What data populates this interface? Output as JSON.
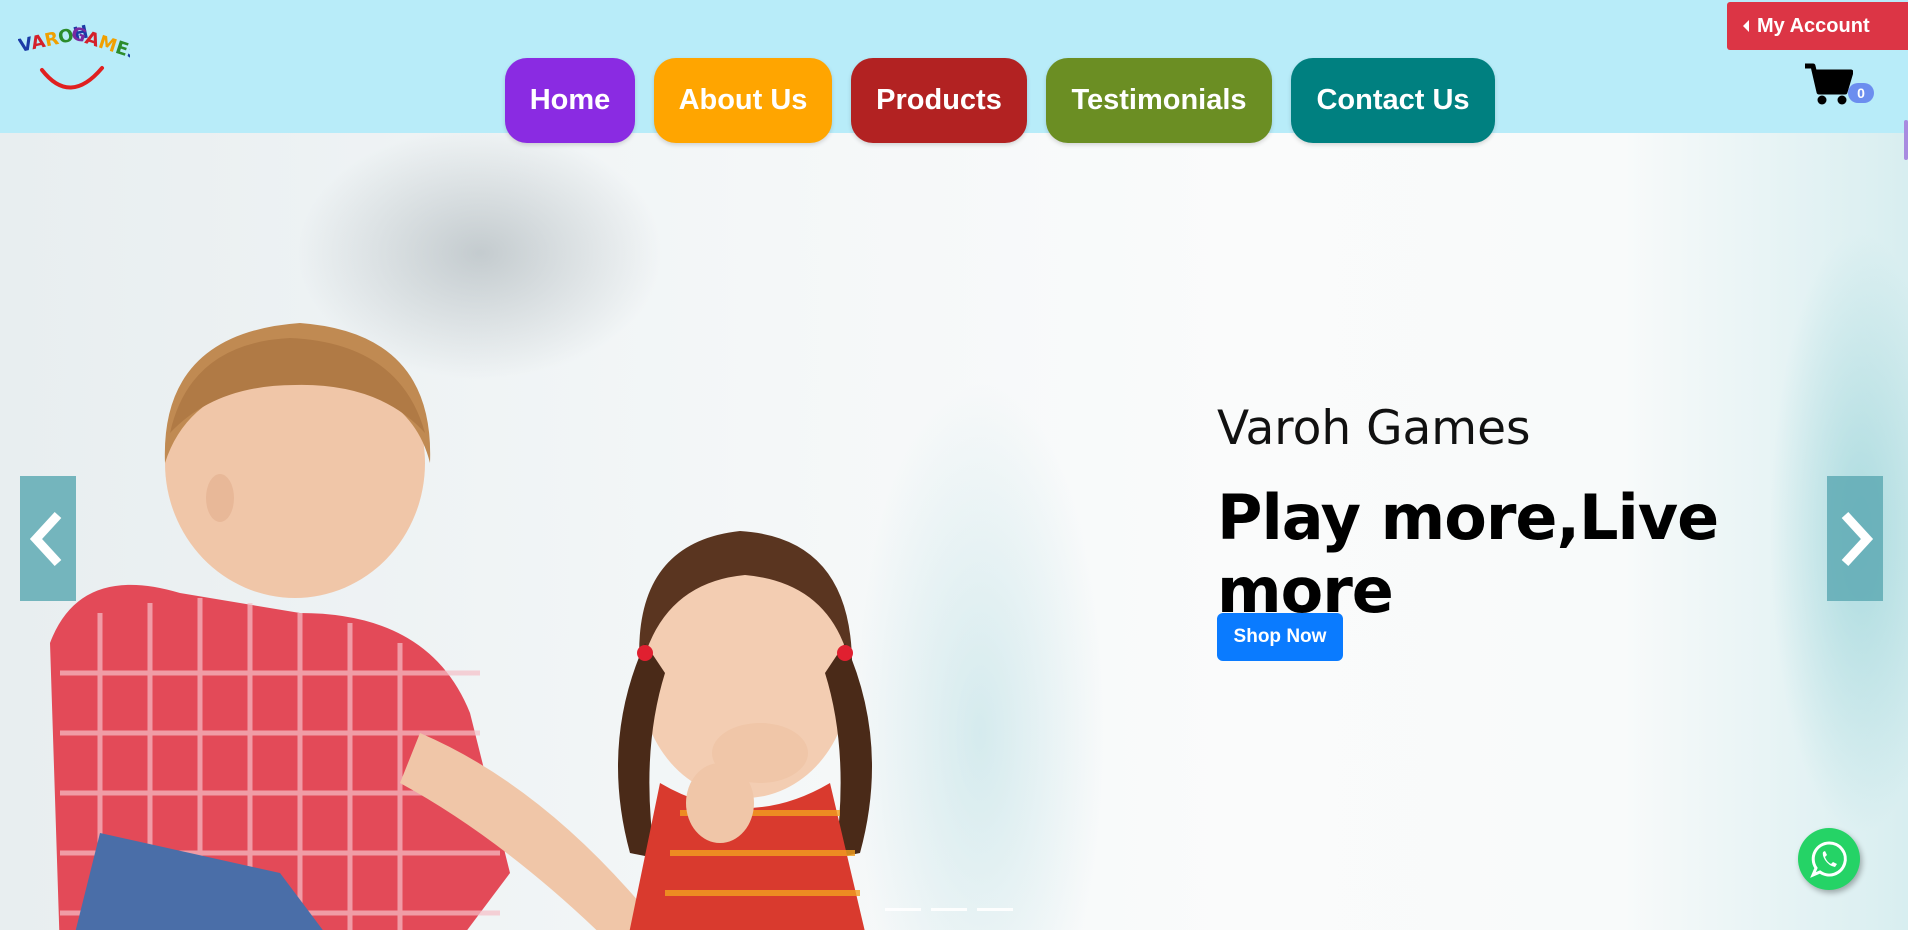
{
  "brand": {
    "logo_text": "VAROH GAMES"
  },
  "nav": {
    "items": [
      {
        "label": "Home",
        "color": "#8a2be2"
      },
      {
        "label": "About Us",
        "color": "#ffa500"
      },
      {
        "label": "Products",
        "color": "#b22222"
      },
      {
        "label": "Testimonials",
        "color": "#6b8e23"
      },
      {
        "label": "Contact Us",
        "color": "#008080"
      }
    ]
  },
  "account": {
    "label": "My Account",
    "icon": "caret-left-icon",
    "color": "#dc3545"
  },
  "cart": {
    "icon": "shopping-cart-icon",
    "count": "0"
  },
  "hero": {
    "subtitle": "Varoh Games",
    "title": "Play more,Live more",
    "cta_label": "Shop Now",
    "cta_color": "#0a7bff",
    "prev_icon": "chevron-left-icon",
    "next_icon": "chevron-right-icon",
    "slides": 3
  },
  "whatsapp": {
    "icon": "whatsapp-icon",
    "color": "#25d366"
  }
}
